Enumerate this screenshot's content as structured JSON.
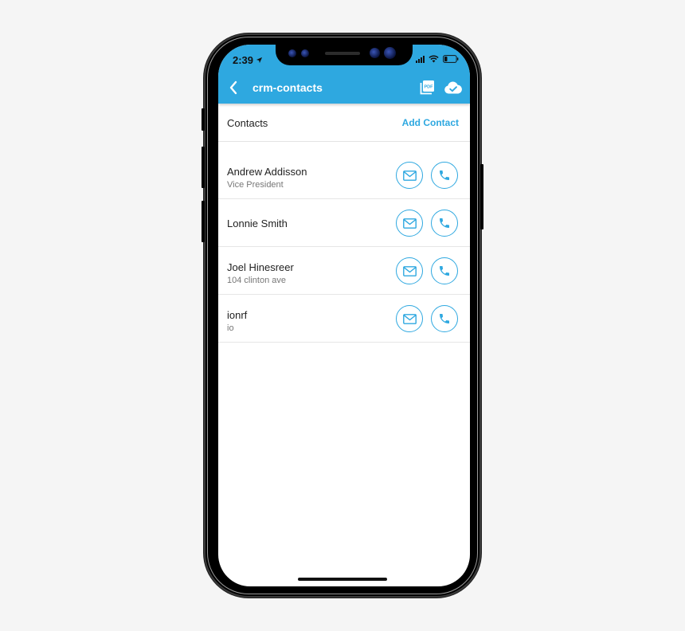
{
  "status_bar": {
    "time": "2:39",
    "location_icon": "location-arrow-icon",
    "signal_icon": "cellular-signal-icon",
    "wifi_icon": "wifi-icon",
    "battery_icon": "battery-icon"
  },
  "navbar": {
    "back_icon": "chevron-left-icon",
    "title": "crm-contacts",
    "pdf_icon": "pdf-export-icon",
    "cloud_icon": "cloud-check-icon"
  },
  "section": {
    "title": "Contacts",
    "add_label": "Add Contact"
  },
  "contacts": [
    {
      "name": "Andrew Addisson",
      "subtitle": "Vice President"
    },
    {
      "name": "Lonnie Smith",
      "subtitle": ""
    },
    {
      "name": "Joel Hinesreer",
      "subtitle": "104 clinton ave"
    },
    {
      "name": "ionrf",
      "subtitle": "io"
    }
  ],
  "action_icons": {
    "email": "envelope-icon",
    "call": "phone-icon"
  },
  "colors": {
    "accent": "#2ea8e0",
    "navbar_bg": "#2ea8e0",
    "text_primary": "#222222",
    "text_secondary": "#777777",
    "divider": "#e6e6e6",
    "page_bg": "#f5f5f5"
  }
}
